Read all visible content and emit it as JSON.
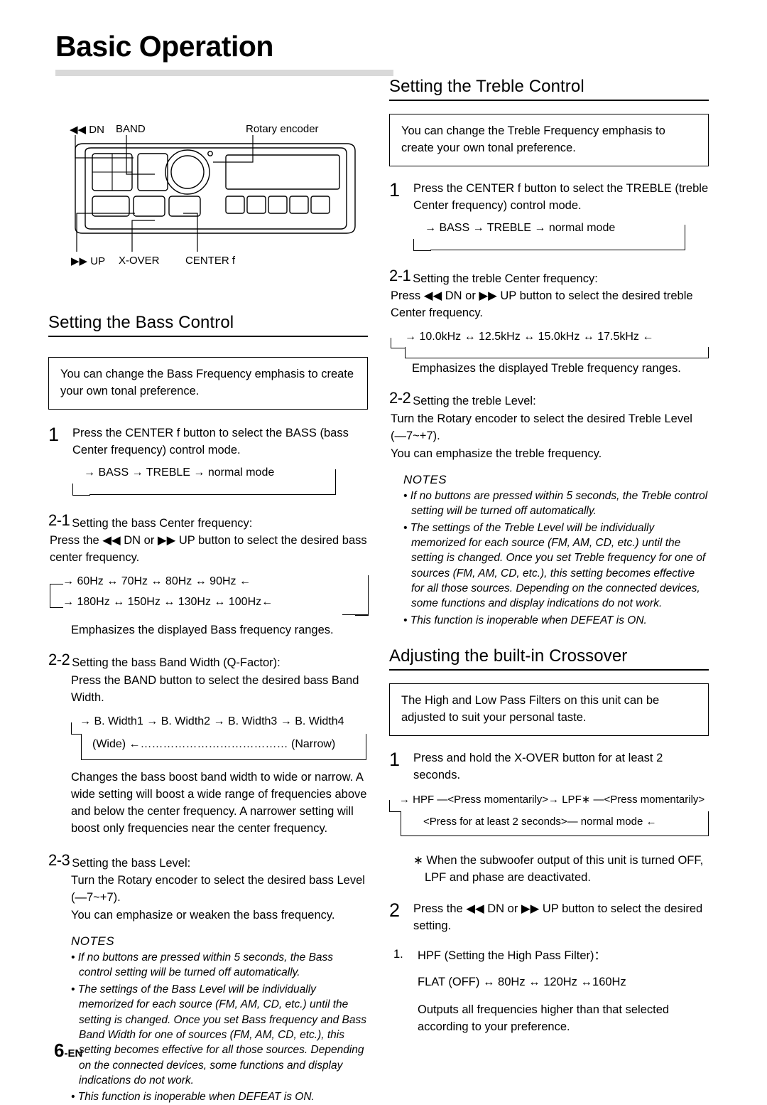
{
  "page": {
    "title": "Basic Operation",
    "footer": "6",
    "footer_suffix": "-EN"
  },
  "diagram": {
    "labels": {
      "dn": "DN",
      "band": "BAND",
      "rotary": "Rotary encoder",
      "up": "UP",
      "xover": "X-OVER",
      "centerf": "CENTER f"
    },
    "icons": {
      "prev": "◀◀",
      "next": "▶▶"
    }
  },
  "bass": {
    "heading": "Setting the Bass Control",
    "intro": "You can change the Bass Frequency emphasis to create your own tonal preference.",
    "step1_num": "1",
    "step1_text": "Press the CENTER f button to select the BASS (bass Center frequency) control mode.",
    "flow1": "→ BASS → TREBLE → normal mode",
    "s21_num": "2-1",
    "s21_title": "Setting the bass Center frequency:",
    "s21_text": "Press the ◀◀ DN or ▶▶ UP button to select the desired bass center frequency.",
    "flow2_line1": "→  60Hz  ↔  70Hz  ↔  80Hz  ↔  90Hz ←",
    "flow2_line2": "→ 180Hz ↔ 150Hz ↔ 130Hz ↔ 100Hz←",
    "flow2_caption": "Emphasizes the displayed Bass frequency ranges.",
    "s22_num": "2-2",
    "s22_title": "Setting the bass Band Width (Q-Factor):",
    "s22_text": "Press the BAND button to select the desired bass Band Width.",
    "flow3_line1": "→ B. Width1 → B. Width2 → B. Width3 → B. Width4",
    "flow3_line2": "(Wide) ←………………………………… (Narrow)",
    "s22_para": "Changes the bass boost band width to wide or narrow. A wide setting will boost a wide range of frequencies above and below the center frequency. A narrower setting will boost only frequencies near the center frequency.",
    "s23_num": "2-3",
    "s23_title": "Setting the bass Level:",
    "s23_text": "Turn the Rotary encoder  to select the desired bass Level (—7~+7).",
    "s23_text2": "You can emphasize or weaken the bass frequency.",
    "notes_title": "NOTES",
    "notes": [
      "• If no buttons are pressed within 5 seconds, the Bass control setting will be turned off automatically.",
      "• The settings of the Bass Level will be individually memorized for each source (FM, AM, CD, etc.) until the setting is changed. Once you set Bass frequency and Bass Band Width for one of sources (FM, AM, CD, etc.), this setting becomes effective for all those sources. Depending on the connected devices, some functions and display indications do not work.",
      "• This function is inoperable when DEFEAT is ON."
    ]
  },
  "treble": {
    "heading": "Setting the Treble Control",
    "intro": "You can change the Treble Frequency emphasis to create your own tonal preference.",
    "step1_num": "1",
    "step1_text": "Press the CENTER f button to select the TREBLE (treble Center frequency) control mode.",
    "flow1": "→ BASS → TREBLE → normal mode",
    "s21_num": "2-1",
    "s21_title": "Setting the treble Center frequency:",
    "s21_text": "Press ◀◀ DN or ▶▶ UP button to select the desired treble Center frequency.",
    "flow2": "→ 10.0kHz ↔ 12.5kHz ↔ 15.0kHz ↔ 17.5kHz ←",
    "flow2_caption": "Emphasizes the displayed Treble frequency ranges.",
    "s22_num": "2-2",
    "s22_title": "Setting the treble Level:",
    "s22_text": "Turn the Rotary encoder  to select the desired Treble Level (—7~+7).",
    "s22_text2": "You can emphasize the treble frequency.",
    "notes_title": "NOTES",
    "notes": [
      "• If no buttons are pressed within 5 seconds, the Treble control setting will be turned off automatically.",
      "• The settings of the Treble Level will be individually memorized for each source (FM, AM, CD, etc.) until the setting is changed. Once you set Treble frequency for one of sources (FM, AM, CD, etc.), this setting becomes effective for all those sources. Depending on the connected devices, some functions and display indications do not work.",
      "• This function is inoperable when DEFEAT is ON."
    ]
  },
  "crossover": {
    "heading": "Adjusting the built-in Crossover",
    "intro": "The High and Low Pass Filters on this unit can be adjusted to suit your personal taste.",
    "step1_num": "1",
    "step1_text": "Press and hold the X-OVER button for at least 2 seconds.",
    "flow_line1": "→ HPF —<Press momentarily>→ LPF∗ —<Press momentarily>",
    "flow_line2": "<Press for at least 2 seconds>— normal mode ←",
    "note_star": "∗  When the subwoofer output of this unit is  turned OFF, LPF and phase are deactivated.",
    "step2_num": "2",
    "step2_text": "Press the ◀◀ DN or ▶▶ UP button to select the desired setting.",
    "item1_num": "1.",
    "item1_text": "HPF (Setting the High Pass Filter)：",
    "item1_values": "FLAT (OFF) ↔ 80Hz ↔ 120Hz ↔160Hz",
    "item1_desc": "Outputs all frequencies higher than that selected according to your preference."
  }
}
